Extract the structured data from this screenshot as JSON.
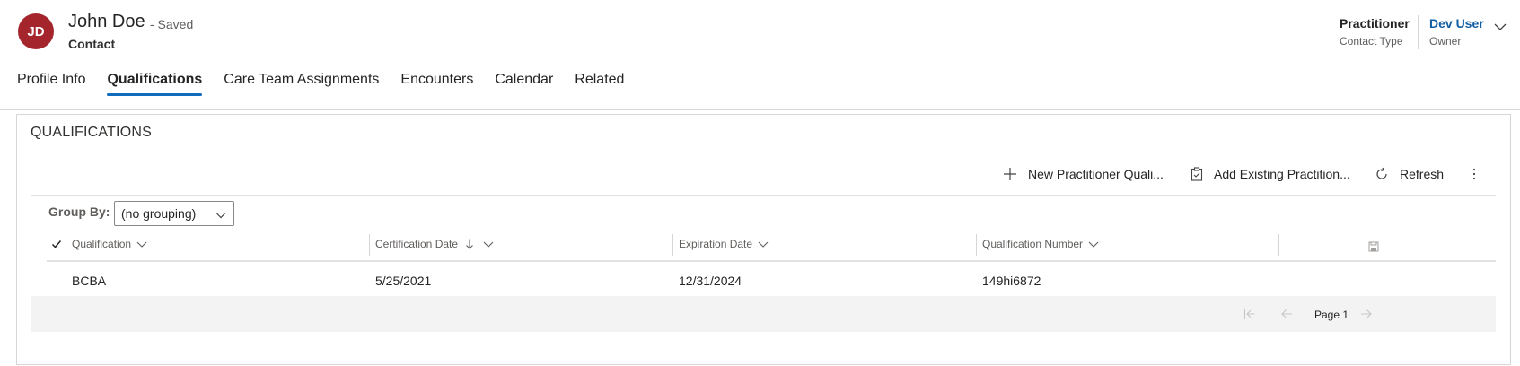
{
  "record": {
    "initials": "JD",
    "name": "John Doe",
    "saved_status": "- Saved",
    "entity_type": "Contact",
    "avatar_color": "#a4262c"
  },
  "header_fields": [
    {
      "value": "Practitioner",
      "label": "Contact Type"
    },
    {
      "value": "Dev User",
      "label": "Owner"
    }
  ],
  "tabs": [
    {
      "label": "Profile Info",
      "active": false
    },
    {
      "label": "Qualifications",
      "active": true
    },
    {
      "label": "Care Team Assignments",
      "active": false
    },
    {
      "label": "Encounters",
      "active": false
    },
    {
      "label": "Calendar",
      "active": false
    },
    {
      "label": "Related",
      "active": false
    }
  ],
  "section": {
    "title": "QUALIFICATIONS",
    "commands": [
      {
        "label": "New Practitioner Quali...",
        "icon": "plus-icon"
      },
      {
        "label": "Add Existing Practition...",
        "icon": "clipboard-icon"
      },
      {
        "label": "Refresh",
        "icon": "refresh-icon"
      }
    ],
    "more_icon": "more-vertical-icon",
    "group_by": {
      "label": "Group By:",
      "value": "(no grouping)"
    }
  },
  "grid": {
    "columns": [
      {
        "label": "Qualification",
        "sort": "none"
      },
      {
        "label": "Certification Date",
        "sort": "desc"
      },
      {
        "label": "Expiration Date",
        "sort": "none"
      },
      {
        "label": "Qualification Number",
        "sort": "none"
      }
    ],
    "rows": [
      [
        "BCBA",
        "5/25/2021",
        "12/31/2024",
        "149hi6872"
      ]
    ]
  },
  "pager": {
    "label": "Page 1"
  },
  "colors": {
    "accent": "#0f6cbd",
    "owner_link": "#115ea3"
  }
}
